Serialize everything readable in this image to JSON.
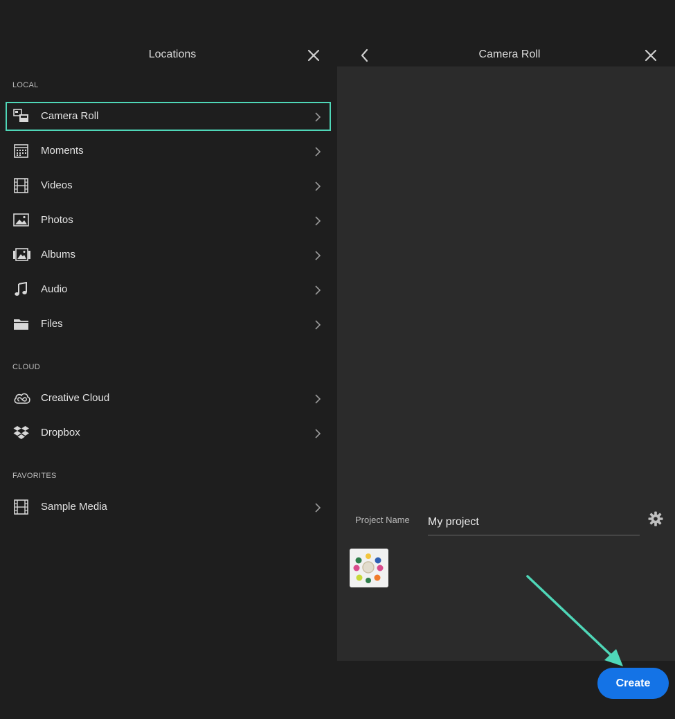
{
  "left_panel": {
    "title": "Locations",
    "sections": {
      "local": "LOCAL",
      "cloud": "CLOUD",
      "favorites": "FAVORITES"
    },
    "items": [
      {
        "label": "Camera Roll",
        "icon": "camera-roll-icon",
        "selected": true
      },
      {
        "label": "Moments",
        "icon": "calendar-icon"
      },
      {
        "label": "Videos",
        "icon": "film-icon"
      },
      {
        "label": "Photos",
        "icon": "image-icon"
      },
      {
        "label": "Albums",
        "icon": "albums-icon"
      },
      {
        "label": "Audio",
        "icon": "music-note-icon"
      },
      {
        "label": "Files",
        "icon": "folder-icon"
      },
      {
        "label": "Creative Cloud",
        "icon": "creative-cloud-icon"
      },
      {
        "label": "Dropbox",
        "icon": "dropbox-icon"
      },
      {
        "label": "Sample Media",
        "icon": "film-icon"
      }
    ]
  },
  "right_panel": {
    "title": "Camera Roll",
    "project_label": "Project Name",
    "project_value": "My project",
    "create_label": "Create"
  },
  "colors": {
    "accent_highlight": "#4fd7b8",
    "create_button": "#1473e6",
    "background": "#1e1e1e",
    "media_area": "#2b2b2b"
  }
}
